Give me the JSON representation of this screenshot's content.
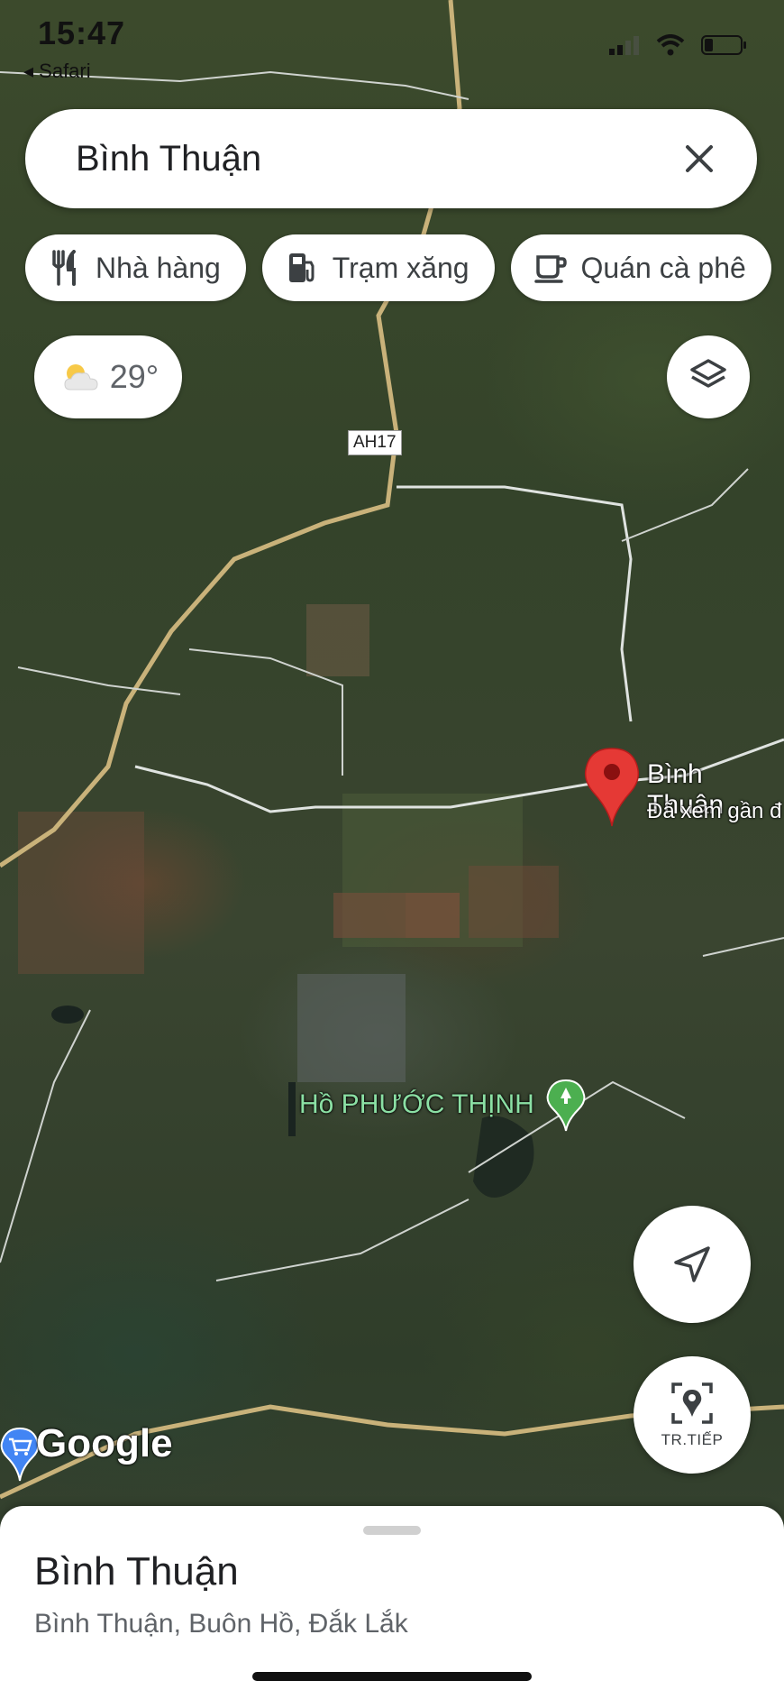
{
  "status_bar": {
    "time": "15:47",
    "back_app": "◂ Safari"
  },
  "search": {
    "query": "Bình Thuận"
  },
  "chips": [
    {
      "label": "Nhà hàng",
      "icon": "restaurant-icon"
    },
    {
      "label": "Trạm xăng",
      "icon": "gas-station-icon"
    },
    {
      "label": "Quán cà phê",
      "icon": "coffee-icon"
    }
  ],
  "weather": {
    "temp": "29°",
    "icon": "partly-cloudy-icon"
  },
  "map": {
    "road_label": "AH17",
    "pin": {
      "title": "Bình Thuận",
      "subtitle": "Đã xem gần đ"
    },
    "lake_label": "Hồ PHƯỚC THỊNH",
    "logo": "Google"
  },
  "controls": {
    "live_label": "TR.TIẾP"
  },
  "place": {
    "name": "Bình Thuận",
    "address": "Bình Thuận, Buôn Hồ, Đắk Lắk"
  },
  "colors": {
    "pin_red": "#e53935",
    "lake_green": "#4caf50",
    "accent_blue": "#4285f4"
  }
}
